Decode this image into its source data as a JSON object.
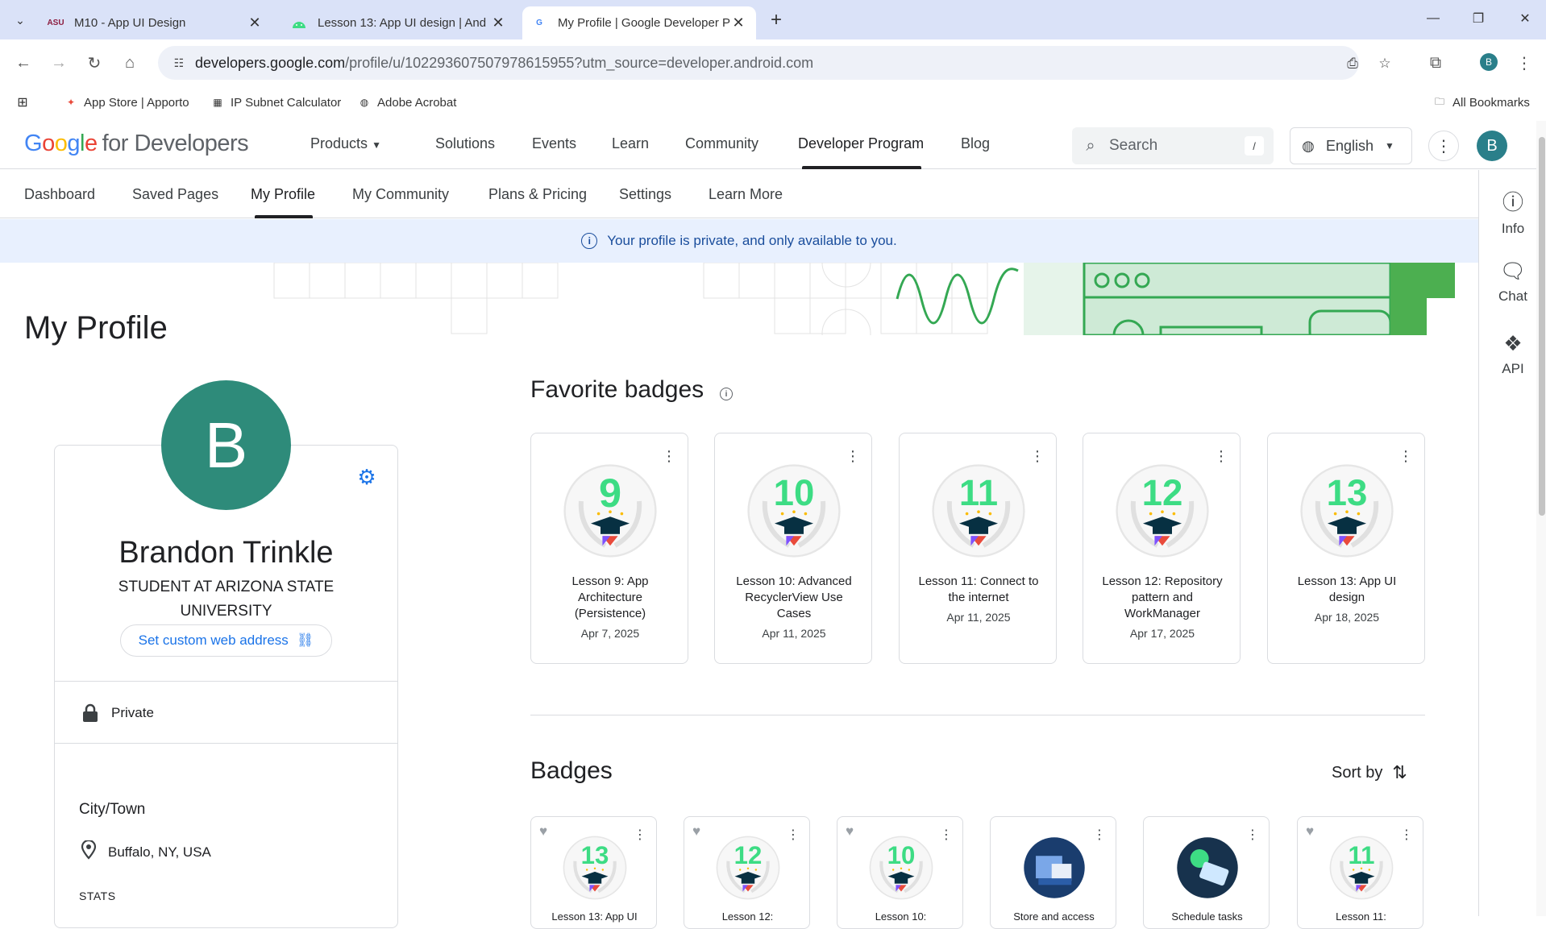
{
  "browser": {
    "tabs": [
      {
        "title": "M10 - App UI Design",
        "favicon": "ASU"
      },
      {
        "title": "Lesson 13: App UI design  |  And",
        "favicon": "android"
      },
      {
        "title": "My Profile | Google Developer P",
        "favicon": "G"
      }
    ],
    "url_host": "developers.google.com",
    "url_path": "/profile/u/102293607507978615955?utm_source=developer.android.com",
    "profile_letter": "B",
    "bookmarks": [
      "App Store | Apporto",
      "IP Subnet Calculator",
      "Adobe Acrobat"
    ],
    "all_bookmarks": "All Bookmarks"
  },
  "site": {
    "logo_google": [
      "G",
      "o",
      "o",
      "g",
      "l",
      "e"
    ],
    "logo_suffix": "for Developers",
    "nav": [
      "Products",
      "Solutions",
      "Events",
      "Learn",
      "Community",
      "Developer Program",
      "Blog"
    ],
    "search_placeholder": "Search",
    "search_key": "/",
    "language": "English",
    "avatar_letter": "B"
  },
  "subnav": [
    "Dashboard",
    "Saved Pages",
    "My Profile",
    "My Community",
    "Plans & Pricing",
    "Settings",
    "Learn More"
  ],
  "side_panel": {
    "info": "Info",
    "chat": "Chat",
    "api": "API"
  },
  "banner": "Your profile is private, and only available to you.",
  "page_title": "My Profile",
  "profile": {
    "avatar_letter": "B",
    "name": "Brandon Trinkle",
    "role": "STUDENT AT ARIZONA STATE UNIVERSITY",
    "custom_url_label": "Set custom web address",
    "privacy": "Private",
    "city_label": "City/Town",
    "city_value": "Buffalo, NY, USA",
    "stats_label": "STATS"
  },
  "favorite_badges": {
    "title": "Favorite badges",
    "items": [
      {
        "number": "9",
        "title": "Lesson 9: App Architecture (Persistence)",
        "date": "Apr 7, 2025"
      },
      {
        "number": "10",
        "title": "Lesson 10: Advanced RecyclerView Use Cases",
        "date": "Apr 11, 2025"
      },
      {
        "number": "11",
        "title": "Lesson 11: Connect to the internet",
        "date": "Apr 11, 2025"
      },
      {
        "number": "12",
        "title": "Lesson 12: Repository pattern and WorkManager",
        "date": "Apr 17, 2025"
      },
      {
        "number": "13",
        "title": "Lesson 13: App UI design",
        "date": "Apr 18, 2025"
      }
    ]
  },
  "badges": {
    "title": "Badges",
    "sort_label": "Sort by",
    "items": [
      {
        "number": "13",
        "title": "Lesson 13: App UI",
        "liked": true
      },
      {
        "number": "12",
        "title": "Lesson 12:",
        "liked": true
      },
      {
        "number": "10",
        "title": "Lesson 10:",
        "liked": true
      },
      {
        "number": "",
        "title": "Store and access",
        "liked": false
      },
      {
        "number": "",
        "title": "Schedule tasks",
        "liked": false
      },
      {
        "number": "11",
        "title": "Lesson 11:",
        "liked": true
      }
    ]
  },
  "colors": {
    "accent": "#1a73e8",
    "avatar": "#2e8b7a",
    "badge_green": "#3ddc84"
  }
}
